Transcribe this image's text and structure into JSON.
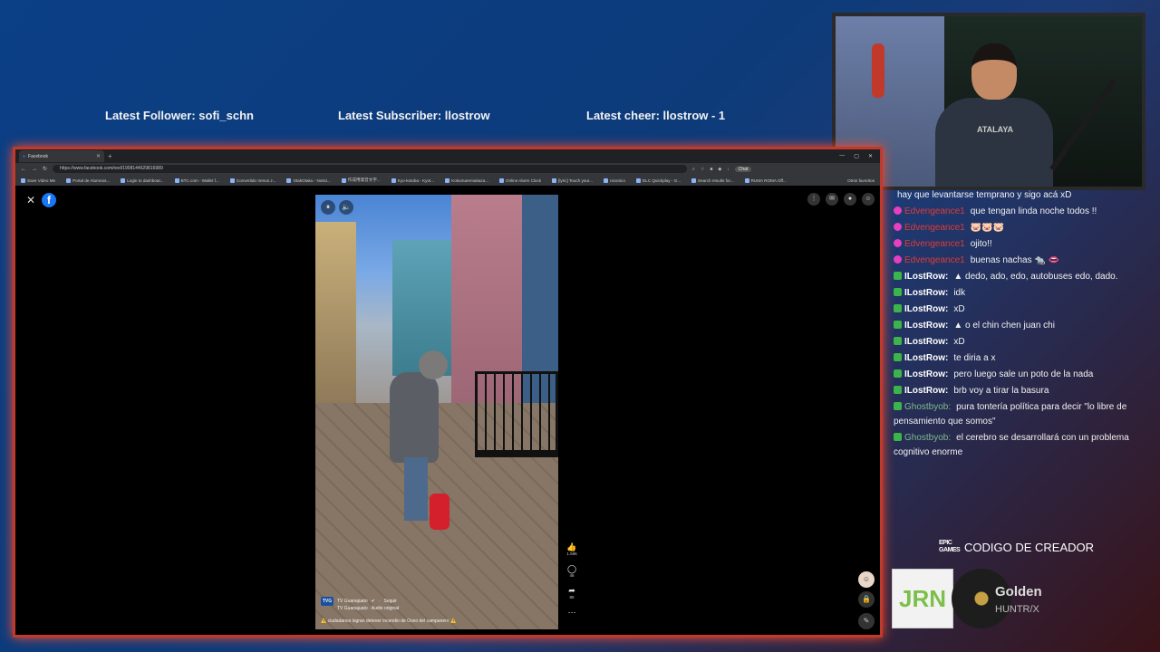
{
  "overlay": {
    "latest_follower": "Latest Follower: sofi_schn",
    "latest_subscriber": "Latest Subscriber: llostrow",
    "latest_cheer": "Latest cheer: llostrow - 1"
  },
  "webcam": {
    "shirt_text": "ATALAYA"
  },
  "browser": {
    "tab_title": "Facebook",
    "url": "https://www.facebook.com/reel/1908144629816989",
    "chat_button": "Chat",
    "bookmarks": [
      "Save Video Me",
      "Portal de Alumnos...",
      "Login to dashboar...",
      "BTC.com - Wallet f...",
      "Convertido Venus J...",
      "OtakOtaku - Notici...",
      "作成用発音文字...",
      "Kyo-kotoba - Kyot...",
      "Kokumaremakaza...",
      "Online Alarm Clock",
      "[lyric] Touch your...",
      "niconico",
      "DLC Quickplay - G...",
      "Search results for...",
      "RUMA ROMA Off..."
    ],
    "other_bookmarks": "Otros favoritos"
  },
  "reel": {
    "channel": "TV Guanajuato",
    "follow": "Seguir",
    "audio": "TV Guanajuato · Audio original",
    "caption": "⚠️ ciudadanos logran detener incendio de Ooxo del campanero ⚠️",
    "likes": "1.596",
    "comments": "46",
    "shares": "86"
  },
  "chat": {
    "messages": [
      {
        "user": "",
        "text": "hay que levantarse temprano y sigo acá xD",
        "color": "#f2f2f2",
        "badge": ""
      },
      {
        "user": "Edvengeance1",
        "text": "que tengan linda noche todos !!",
        "color": "#e23a35",
        "badge": "pink"
      },
      {
        "user": "Edvengeance1",
        "text": "🐷🐷🐷",
        "color": "#e23a35",
        "badge": "pink"
      },
      {
        "user": "Edvengeance1",
        "text": "ojito!!",
        "color": "#e23a35",
        "badge": "pink"
      },
      {
        "user": "Edvengeance1",
        "text": "buenas nachas 🐀 👄",
        "color": "#e23a35",
        "badge": "pink"
      },
      {
        "user": "ILostRow:",
        "text": "▲ dedo, ado, edo, autobuses edo, dado.",
        "color": "#ffffff",
        "badge": "green"
      },
      {
        "user": "ILostRow:",
        "text": "idk",
        "color": "#ffffff",
        "badge": "green"
      },
      {
        "user": "ILostRow:",
        "text": "xD",
        "color": "#ffffff",
        "badge": "green"
      },
      {
        "user": "ILostRow:",
        "text": "▲ o el chin chen juan chi",
        "color": "#ffffff",
        "badge": "green"
      },
      {
        "user": "ILostRow:",
        "text": "xD",
        "color": "#ffffff",
        "badge": "green"
      },
      {
        "user": "ILostRow:",
        "text": "te diria a x",
        "color": "#ffffff",
        "badge": "green"
      },
      {
        "user": "ILostRow:",
        "text": "pero luego sale un poto de la nada",
        "color": "#ffffff",
        "badge": "green"
      },
      {
        "user": "ILostRow:",
        "text": "brb voy a tirar la basura",
        "color": "#ffffff",
        "badge": "green"
      },
      {
        "user": "Ghostbyob:",
        "text": "pura tontería política para decir \"lo libre de pensamiento que somos\"",
        "color": "#7fb98d",
        "badge": "green"
      },
      {
        "user": "Ghostbyob:",
        "text": "el cerebro se desarrollará con un problema cognitivo enorme",
        "color": "#7fb98d",
        "badge": "green"
      }
    ]
  },
  "epic": {
    "logo": "EPIC GAMES",
    "label": "CODIGO DE CREADOR"
  },
  "now_playing": {
    "album_art_text": "JRN",
    "title": "Golden",
    "artist": "HUNTR/X"
  }
}
